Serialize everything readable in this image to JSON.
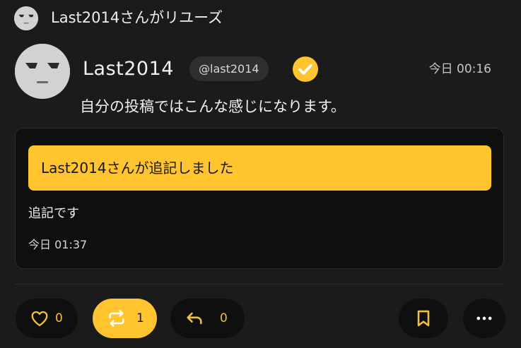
{
  "repost_header": {
    "text": "Last2014さんがリユーズ",
    "avatar_icon": "face-avatar-icon"
  },
  "post": {
    "author_name": "Last2014",
    "handle": "@last2014",
    "verified_icon": "verified-check-icon",
    "timestamp": "今日 00:16",
    "body": "自分の投稿ではこんな感じになります。"
  },
  "addendum": {
    "banner": "Last2014さんが追記しました",
    "body": "追記です",
    "timestamp": "今日 01:37"
  },
  "actions": {
    "like_count": "0",
    "repost_count": "1",
    "reply_count": "0",
    "like_icon": "heart-icon",
    "repost_icon": "repost-icon",
    "reply_icon": "reply-icon",
    "bookmark_icon": "bookmark-icon",
    "more_icon": "more-icon"
  },
  "colors": {
    "background": "#1b1b1b",
    "accent": "#ffc42e",
    "card": "#0f0f0f",
    "text": "#ececec"
  }
}
